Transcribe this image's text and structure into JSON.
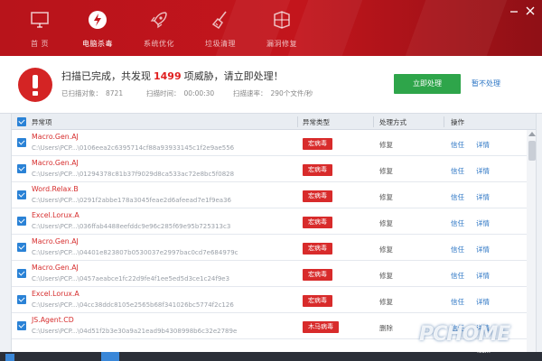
{
  "window": {
    "title": ""
  },
  "nav": {
    "items": [
      {
        "label": "首 页",
        "icon": "monitor-icon"
      },
      {
        "label": "电脑杀毒",
        "icon": "shield-icon",
        "active": true
      },
      {
        "label": "系统优化",
        "icon": "rocket-icon"
      },
      {
        "label": "垃圾清理",
        "icon": "broom-icon"
      },
      {
        "label": "漏洞修复",
        "icon": "patch-icon"
      }
    ]
  },
  "status": {
    "headline_prefix": "扫描已完成，共发现",
    "threat_count": "1499",
    "headline_suffix": "项威胁，请立即处理！",
    "scanned_label": "已扫描对象：",
    "scanned_value": "8721",
    "time_label": "扫描时间：",
    "time_value": "00:00:30",
    "speed_label": "扫描速率：",
    "speed_value": "290个文件/秒",
    "primary_button": "立即处理",
    "secondary_link": "暂不处理"
  },
  "table": {
    "headers": {
      "item": "异常项",
      "type": "异常类型",
      "handling": "处理方式",
      "action": "操作"
    },
    "rows": [
      {
        "name": "Macro.Gen.AJ",
        "path": "C:\\Users\\PCP...\\0106eea2c6395714cf88a93933145c1f2e9ae556",
        "type": "宏病毒",
        "handling": "修复",
        "trust": "信任",
        "detail": "详情"
      },
      {
        "name": "Macro.Gen.AJ",
        "path": "C:\\Users\\PCP...\\01294378c81b37f9029d8ca533ac72e8bc5f0828",
        "type": "宏病毒",
        "handling": "修复",
        "trust": "信任",
        "detail": "详情"
      },
      {
        "name": "Word.Relax.B",
        "path": "C:\\Users\\PCP...\\0291f2abbe178a3045feae2d6afeead7e1f9ea36",
        "type": "宏病毒",
        "handling": "修复",
        "trust": "信任",
        "detail": "详情"
      },
      {
        "name": "Excel.Lorux.A",
        "path": "C:\\Users\\PCP...\\036ffab4488eefddc9e96c285f69e95b725313c3",
        "type": "宏病毒",
        "handling": "修复",
        "trust": "信任",
        "detail": "详情"
      },
      {
        "name": "Macro.Gen.AJ",
        "path": "C:\\Users\\PCP...\\04401e823807b0530037e2997bac0cd7e684979c",
        "type": "宏病毒",
        "handling": "修复",
        "trust": "信任",
        "detail": "详情"
      },
      {
        "name": "Macro.Gen.AJ",
        "path": "C:\\Users\\PCP...\\0457aeabce1fc22d9fe4f1ee5ed5d3ce1c24f9e3",
        "type": "宏病毒",
        "handling": "修复",
        "trust": "信任",
        "detail": "详情"
      },
      {
        "name": "Excel.Lorux.A",
        "path": "C:\\Users\\PCP...\\04cc38ddc8105e2565b68f341026bc5774f2c126",
        "type": "宏病毒",
        "handling": "修复",
        "trust": "信任",
        "detail": "详情"
      },
      {
        "name": "JS.Agent.CD",
        "path": "C:\\Users\\PCP...\\04d51f2b3e30a9a21ead9b4308998b6c32e2789e",
        "type": "木马病毒",
        "handling": "删除",
        "trust": "信任",
        "detail": "详情"
      }
    ]
  },
  "watermark": {
    "logo": "PCHOME",
    "site": ".com"
  },
  "colors": {
    "header_red": "#c3151c",
    "threat_red": "#d82b2b",
    "action_green": "#2ea54a",
    "link_blue": "#2a74c4",
    "checkbox_blue": "#2a82d6"
  }
}
